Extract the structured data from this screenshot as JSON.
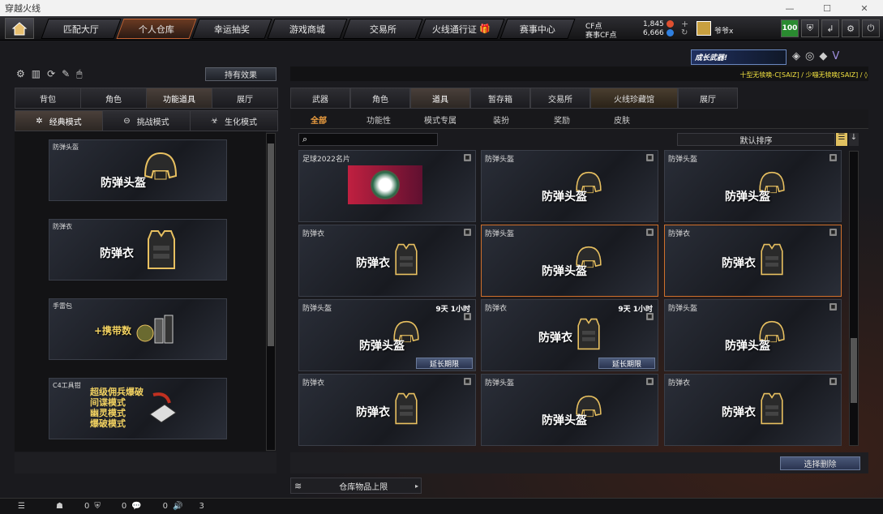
{
  "window": {
    "title": "穿越火线"
  },
  "nav": {
    "tabs": [
      "匹配大厅",
      "个人仓库",
      "幸运抽奖",
      "游戏商城",
      "交易所",
      "火线通行证",
      "赛事中心"
    ],
    "cf_label": "CF点",
    "cf_value": "1,845",
    "cf_event_label": "赛事CF点",
    "cf_event_value": "6,666",
    "nickname": "爷爷x",
    "level": "100"
  },
  "left": {
    "effect_btn": "持有效果",
    "tabs": [
      "背包",
      "角色",
      "功能道具",
      "展厅"
    ],
    "modes": [
      "经典模式",
      "挑战模式",
      "生化模式"
    ],
    "cards": [
      {
        "label": "防弹头盔",
        "name": "防弹头盔"
      },
      {
        "label": "防弹衣",
        "name": "防弹衣"
      },
      {
        "label": "手雷包",
        "name": "+携带数"
      },
      {
        "label": "C4工具钳",
        "lines": [
          "超级佣兵爆破",
          "间谍模式",
          "幽灵模式",
          "爆破模式"
        ]
      }
    ]
  },
  "right": {
    "banner": "成长武器!",
    "marquee": "十型无犊唤-C[SAIZ] / 少嘣无犊唤[SAIZ] / ◊",
    "tabs": [
      "武器",
      "角色",
      "道具",
      "暂存箱",
      "交易所",
      "火线珍藏馆",
      "展厅"
    ],
    "subtabs": [
      "全部",
      "功能性",
      "模式专属",
      "装扮",
      "奖励",
      "皮肤"
    ],
    "sort": "默认排序",
    "search_placeholder": "",
    "items": [
      {
        "label": "足球2022名片",
        "name": "",
        "type": "card"
      },
      {
        "label": "防弹头盔",
        "name": "防弹头盔",
        "type": "helmet"
      },
      {
        "label": "防弹头盔",
        "name": "防弹头盔",
        "type": "helmet"
      },
      {
        "label": "防弹衣",
        "name": "防弹衣",
        "type": "vest"
      },
      {
        "label": "防弹头盔",
        "name": "防弹头盔",
        "type": "helmet",
        "selected": true
      },
      {
        "label": "防弹衣",
        "name": "防弹衣",
        "type": "vest",
        "selected": true
      },
      {
        "label": "防弹头盔",
        "name": "防弹头盔",
        "type": "helmet",
        "timer": "9天 1小时",
        "extend": "延长期限"
      },
      {
        "label": "防弹衣",
        "name": "防弹衣",
        "type": "vest",
        "timer": "9天 1小时",
        "extend": "延长期限"
      },
      {
        "label": "防弹头盔",
        "name": "防弹头盔",
        "type": "helmet"
      },
      {
        "label": "防弹衣",
        "name": "防弹衣",
        "type": "vest"
      },
      {
        "label": "防弹头盔",
        "name": "防弹头盔",
        "type": "helmet"
      },
      {
        "label": "防弹衣",
        "name": "防弹衣",
        "type": "vest"
      }
    ],
    "select_delete": "选择删除",
    "storage_limit": "仓库物品上限"
  },
  "bottom": {
    "counts": [
      "0",
      "0",
      "0",
      "3"
    ]
  },
  "colors": {
    "accent": "#c06030",
    "selected_border": "#d0702c"
  }
}
